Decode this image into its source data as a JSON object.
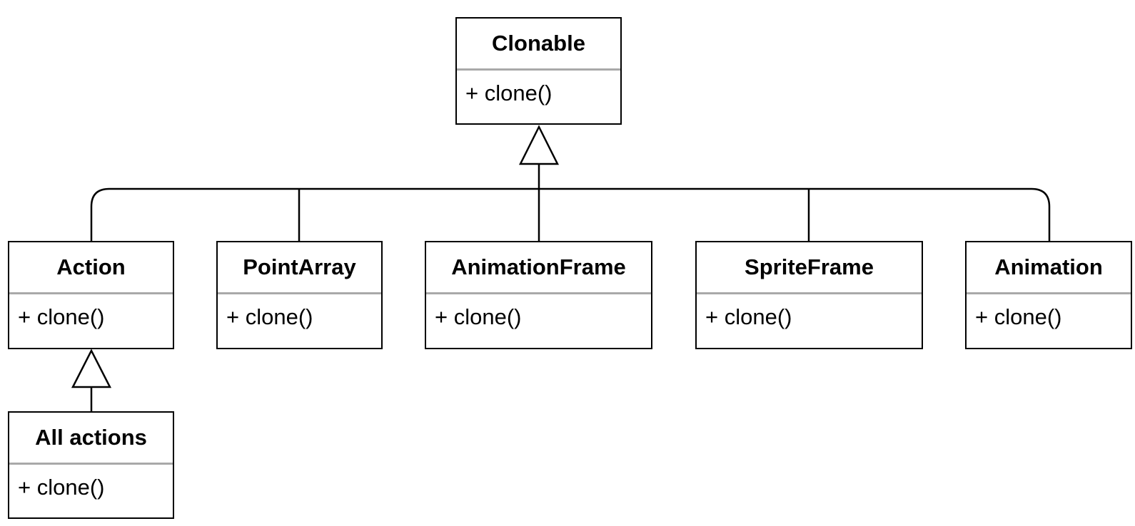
{
  "diagram": {
    "type": "uml-class-inheritance",
    "line_color": "#000000",
    "divider_color": "#a9a9a9",
    "classes": [
      {
        "id": "clonable",
        "name": "Clonable",
        "operations": [
          "+ clone()"
        ]
      },
      {
        "id": "action",
        "name": "Action",
        "operations": [
          "+ clone()"
        ]
      },
      {
        "id": "pointarray",
        "name": "PointArray",
        "operations": [
          "+ clone()"
        ]
      },
      {
        "id": "animationframe",
        "name": "AnimationFrame",
        "operations": [
          "+ clone()"
        ]
      },
      {
        "id": "spriteframe",
        "name": "SpriteFrame",
        "operations": [
          "+ clone()"
        ]
      },
      {
        "id": "animation",
        "name": "Animation",
        "operations": [
          "+ clone()"
        ]
      },
      {
        "id": "allactions",
        "name": "All actions",
        "operations": [
          "+ clone()"
        ]
      }
    ],
    "relations": [
      {
        "type": "generalization",
        "from": "action",
        "to": "clonable"
      },
      {
        "type": "generalization",
        "from": "pointarray",
        "to": "clonable"
      },
      {
        "type": "generalization",
        "from": "animationframe",
        "to": "clonable"
      },
      {
        "type": "generalization",
        "from": "spriteframe",
        "to": "clonable"
      },
      {
        "type": "generalization",
        "from": "animation",
        "to": "clonable"
      },
      {
        "type": "generalization",
        "from": "allactions",
        "to": "action"
      }
    ]
  }
}
